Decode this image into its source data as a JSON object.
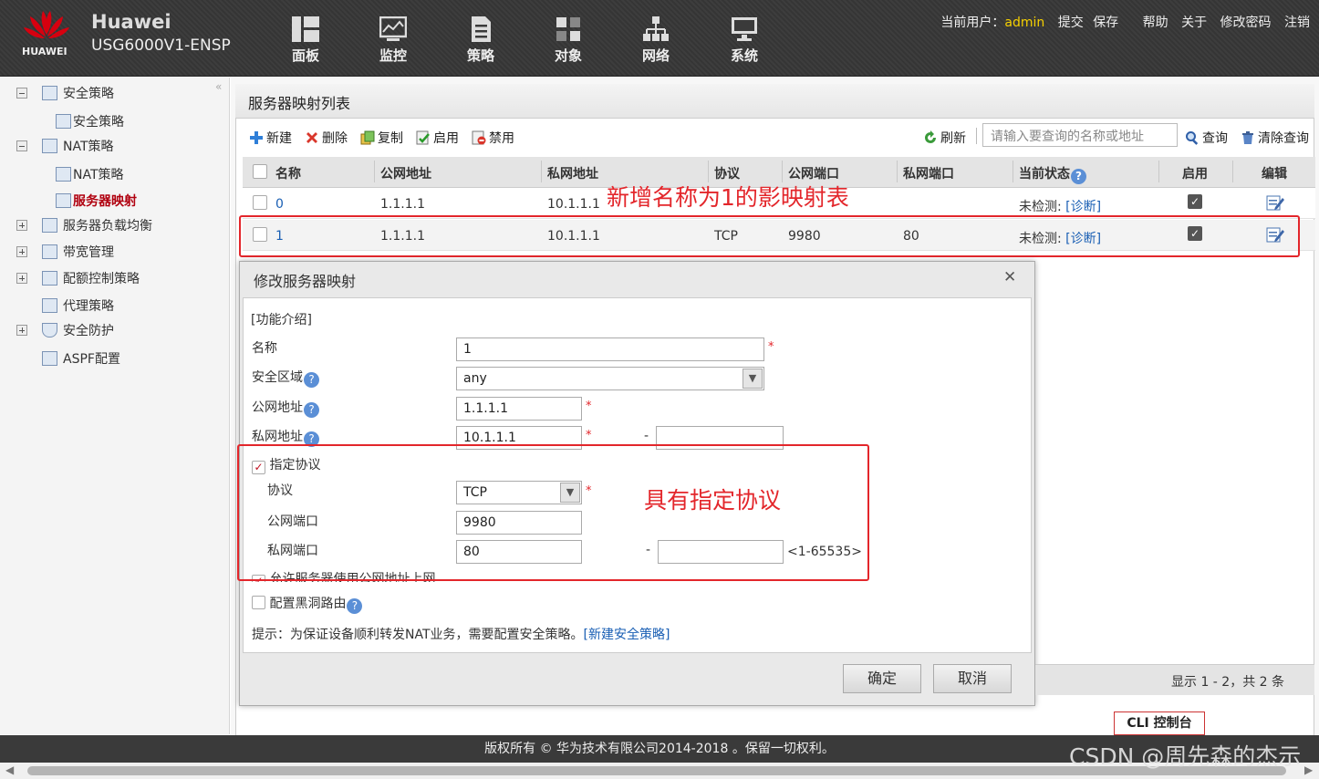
{
  "header": {
    "brand_name": "Huawei",
    "brand_model": "USG6000V1-ENSP",
    "logo_text": "HUAWEI",
    "nav": [
      {
        "label": "面板",
        "icon": "dashboard-icon"
      },
      {
        "label": "监控",
        "icon": "monitor-icon"
      },
      {
        "label": "策略",
        "icon": "policy-icon"
      },
      {
        "label": "对象",
        "icon": "object-icon"
      },
      {
        "label": "网络",
        "icon": "network-icon"
      },
      {
        "label": "系统",
        "icon": "system-icon"
      }
    ],
    "user_prefix": "当前用户：",
    "user": "admin",
    "links": [
      "提交",
      "保存",
      "帮助",
      "关于",
      "修改密码",
      "注销"
    ]
  },
  "sidebar": {
    "items": [
      {
        "label": "安全策略"
      },
      {
        "label": "安全策略"
      },
      {
        "label": "NAT策略"
      },
      {
        "label": "NAT策略"
      },
      {
        "label": "服务器映射"
      },
      {
        "label": "服务器负载均衡"
      },
      {
        "label": "带宽管理"
      },
      {
        "label": "配额控制策略"
      },
      {
        "label": "代理策略"
      },
      {
        "label": "安全防护"
      },
      {
        "label": "ASPF配置"
      }
    ]
  },
  "panel": {
    "title": "服务器映射列表",
    "toolbar": {
      "new": "新建",
      "delete": "删除",
      "copy": "复制",
      "enable": "启用",
      "disable": "禁用",
      "refresh": "刷新",
      "search_placeholder": "请输入要查询的名称或地址",
      "query": "查询",
      "clear_query": "清除查询"
    },
    "columns": [
      "名称",
      "公网地址",
      "私网地址",
      "协议",
      "公网端口",
      "私网端口",
      "当前状态",
      "启用",
      "编辑"
    ],
    "rows": [
      {
        "name": "0",
        "public_ip": "1.1.1.1",
        "private_ip": "10.1.1.1",
        "protocol": "",
        "public_port": "",
        "private_port": "",
        "status": "未检测:",
        "diag": "[诊断]",
        "enabled": true
      },
      {
        "name": "1",
        "public_ip": "1.1.1.1",
        "private_ip": "10.1.1.1",
        "protocol": "TCP",
        "public_port": "9980",
        "private_port": "80",
        "status": "未检测:",
        "diag": "[诊断]",
        "enabled": true
      }
    ],
    "pager": "显示 1 - 2，共 2 条"
  },
  "annotations": {
    "table": "新增名称为1的影映射表",
    "dialog": "具有指定协议"
  },
  "dialog": {
    "title": "修改服务器映射",
    "intro_link": "[功能介绍]",
    "fields": {
      "name_label": "名称",
      "name_value": "1",
      "zone_label": "安全区域",
      "zone_value": "any",
      "public_label": "公网地址",
      "public_value": "1.1.1.1",
      "private_label": "私网地址",
      "private_value": "10.1.1.1",
      "specify_protocol": "指定协议",
      "protocol_label": "协议",
      "protocol_value": "TCP",
      "pub_port_label": "公网端口",
      "pub_port_value": "9980",
      "priv_port_label": "私网端口",
      "priv_port_value": "80",
      "port_range_hint": "<1-65535>",
      "allow_internet": "允许服务器使用公网地址上网",
      "blackhole": "配置黑洞路由"
    },
    "hint": "提示：为保证设备顺利转发NAT业务，需要配置安全策略。",
    "hint_link": "[新建安全策略]",
    "ok": "确定",
    "cancel": "取消"
  },
  "cli_button": "CLI 控制台",
  "footer": "版权所有 © 华为技术有限公司2014-2018 。保留一切权利。",
  "watermark": "CSDN @周先森的杰示"
}
